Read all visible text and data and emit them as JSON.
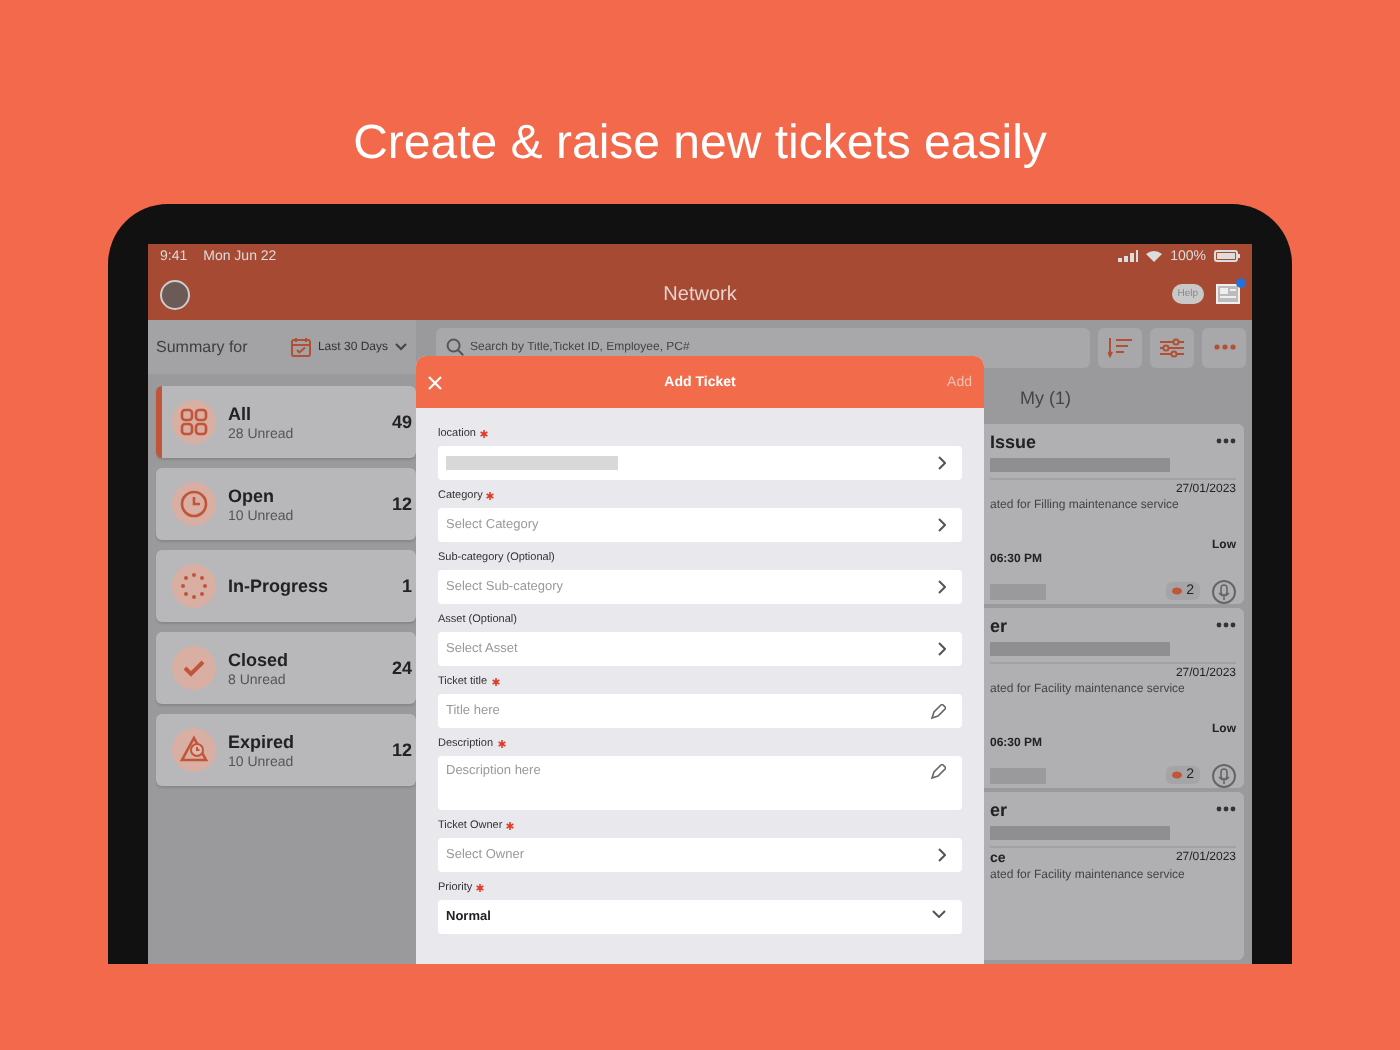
{
  "headline": "Create & raise new tickets easily",
  "status_bar": {
    "time": "9:41",
    "date": "Mon Jun 22",
    "battery": "100%"
  },
  "nav_bar": {
    "title": "Network",
    "help_label": "Help",
    "notification_dot": true
  },
  "summary": {
    "label": "Summary for",
    "period": "Last 30 Days"
  },
  "search": {
    "placeholder": "Search by Title,Ticket ID, Employee, PC#"
  },
  "categories": [
    {
      "name": "All",
      "unread": "28 Unread",
      "count": "49",
      "selected": true
    },
    {
      "name": "Open",
      "unread": "10 Unread",
      "count": "12",
      "selected": false
    },
    {
      "name": "In-Progress",
      "count": "1",
      "selected": false
    },
    {
      "name": "Closed",
      "unread": "8 Unread",
      "count": "24",
      "selected": false
    },
    {
      "name": "Expired",
      "unread": "10 Unread",
      "count": "12",
      "selected": false
    }
  ],
  "tab_label": "My (1)",
  "tickets": [
    {
      "title": "Issue",
      "date": "27/01/2023",
      "description": "ated for Filling maintenance service",
      "priority": "Low",
      "time": "06:30 PM",
      "comments": "2"
    },
    {
      "title": "er",
      "date": "27/01/2023",
      "description": "ated for Facility maintenance service",
      "priority": "Low",
      "time": "06:30 PM",
      "comments": "2"
    },
    {
      "title": "er",
      "subtitle": "ce",
      "date": "27/01/2023",
      "description": "ated for Facility maintenance service"
    }
  ],
  "modal": {
    "title": "Add Ticket",
    "action": "Add",
    "fields": [
      {
        "kind": "select",
        "label": "location",
        "required": true,
        "masked": true
      },
      {
        "kind": "select",
        "label": "Category",
        "required": true,
        "placeholder": "Select Category"
      },
      {
        "kind": "select",
        "label": "Sub-category (Optional)",
        "required": false,
        "placeholder": "Select Sub-category"
      },
      {
        "kind": "select",
        "label": "Asset (Optional)",
        "required": false,
        "placeholder": "Select Asset"
      },
      {
        "kind": "text",
        "label": "Ticket title",
        "required": true,
        "placeholder": "Title here"
      },
      {
        "kind": "textarea",
        "label": "Description",
        "required": true,
        "placeholder": "Description here"
      },
      {
        "kind": "select",
        "label": "Ticket Owner",
        "required": true,
        "placeholder": "Select Owner"
      },
      {
        "kind": "dropdown",
        "label": "Priority",
        "required": true,
        "value": "Normal"
      }
    ]
  }
}
